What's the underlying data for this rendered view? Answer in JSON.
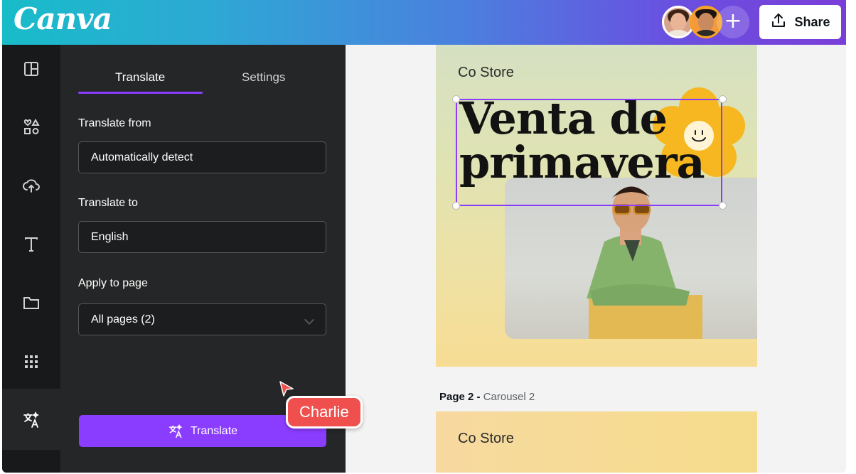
{
  "header": {
    "logo_text": "Canva",
    "add_collaborator": "+",
    "share_label": "Share"
  },
  "rail": {
    "items": [
      "templates-icon",
      "elements-icon",
      "uploads-icon",
      "text-icon",
      "projects-icon",
      "apps-icon",
      "translate-icon"
    ]
  },
  "panel": {
    "tabs": [
      {
        "label": "Translate",
        "active": true
      },
      {
        "label": "Settings",
        "active": false
      }
    ],
    "translate_from_label": "Translate from",
    "translate_from_value": "Automatically detect",
    "translate_to_label": "Translate to",
    "translate_to_value": "English",
    "apply_to_page_label": "Apply to page",
    "apply_to_page_value": "All pages (2)",
    "translate_button": "Translate"
  },
  "cursor": {
    "name": "Charlie",
    "color": "#f0504d"
  },
  "canvas": {
    "page1": {
      "store_name": "Co Store",
      "headline_line1": "Venta de",
      "headline_line2": "primavera"
    },
    "page2": {
      "label_bold": "Page 2 -",
      "label_sub": "Carousel 2",
      "store_name": "Co Store"
    }
  },
  "colors": {
    "accent": "#8b3dff",
    "panel_bg": "#252627",
    "rail_bg": "#18191b"
  }
}
